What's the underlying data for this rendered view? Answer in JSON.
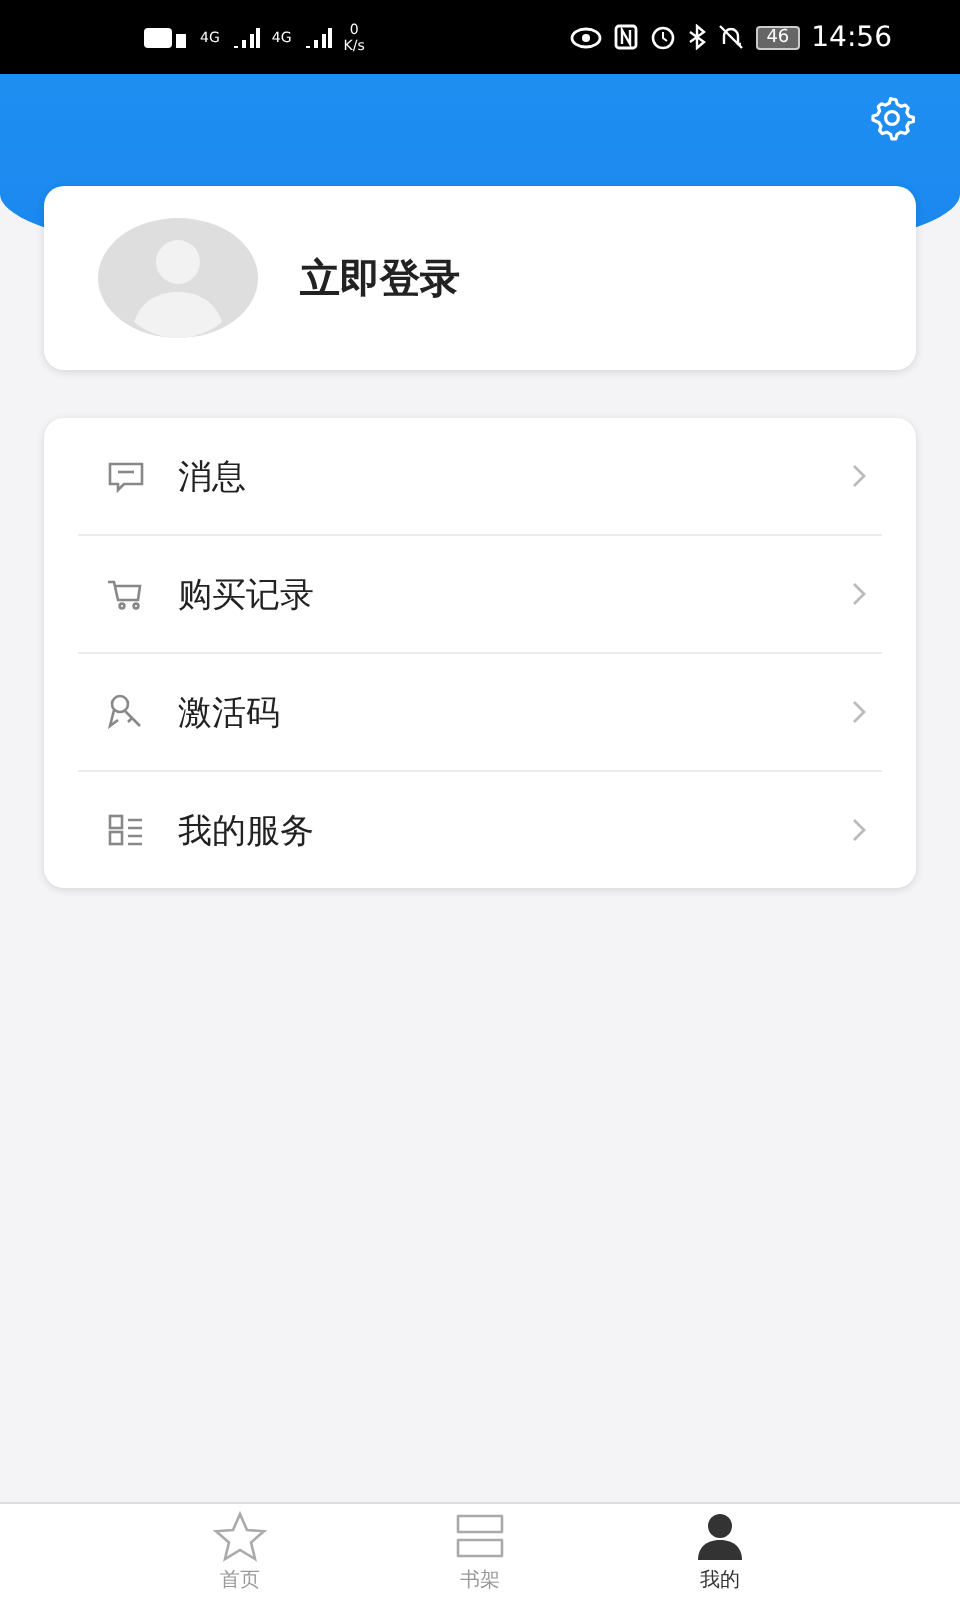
{
  "status_bar": {
    "network_1": "4G",
    "network_2": "4G",
    "speed_value": "0",
    "speed_unit": "K/s",
    "battery": "46",
    "time": "14:56"
  },
  "profile": {
    "login_label": "立即登录"
  },
  "menu": [
    {
      "label": "消息",
      "kind": "message"
    },
    {
      "label": "购买记录",
      "kind": "cart"
    },
    {
      "label": "激活码",
      "kind": "key"
    },
    {
      "label": "我的服务",
      "kind": "list"
    }
  ],
  "tabs": [
    {
      "label": "首页",
      "kind": "star",
      "selected": false
    },
    {
      "label": "书架",
      "kind": "shelf",
      "selected": false
    },
    {
      "label": "我的",
      "kind": "person",
      "selected": true
    }
  ]
}
